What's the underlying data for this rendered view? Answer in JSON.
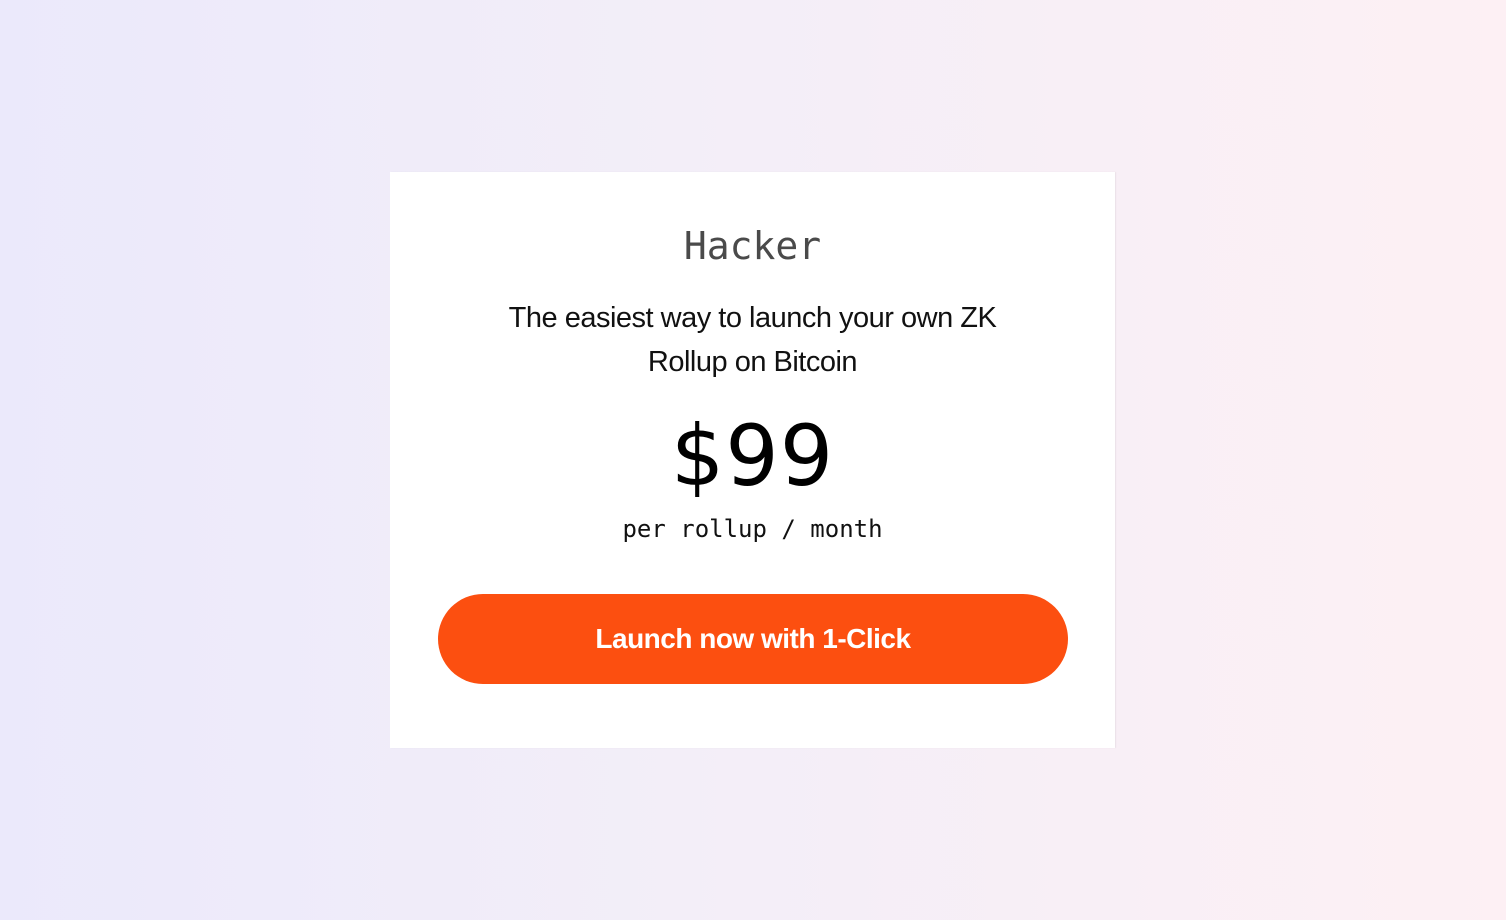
{
  "plan": {
    "name": "Hacker",
    "tagline": "The easiest way to launch your own ZK Rollup on Bitcoin",
    "price": "$99",
    "price_note": "per rollup / month",
    "cta_label": "Launch now with 1-Click"
  },
  "colors": {
    "accent": "#fc4f10",
    "card_background": "#ffffff",
    "page_gradient_start": "#ebe9fb",
    "page_gradient_end": "#fdf0f4"
  }
}
